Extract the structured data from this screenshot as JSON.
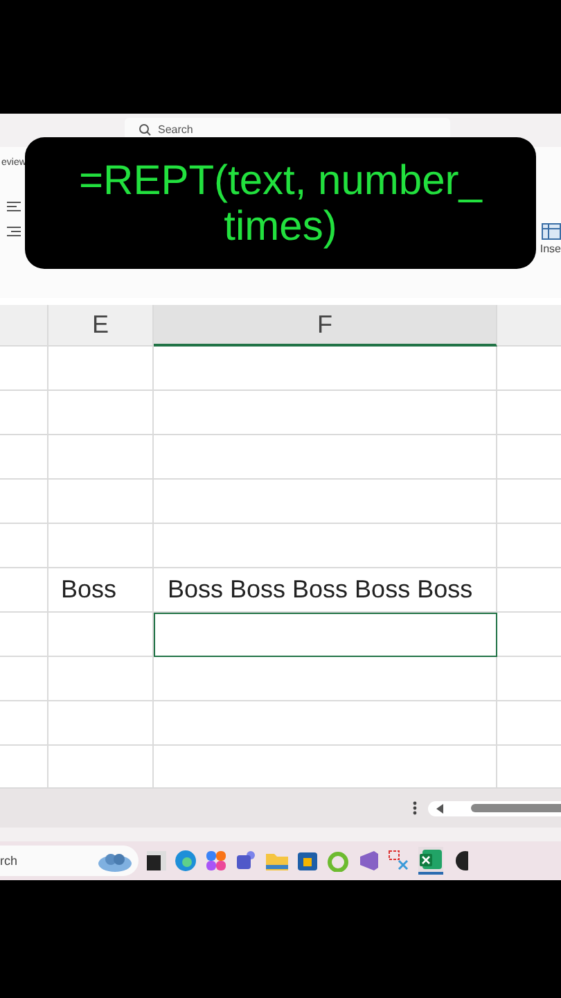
{
  "ribbon": {
    "search": {
      "placeholder": "Search"
    },
    "tab_fragment": "eview",
    "right_button": "Inse"
  },
  "caption": {
    "line_1": "=REPT(text, number_",
    "line_2": "times)"
  },
  "sheet": {
    "columns": [
      {
        "label": "E",
        "selected": false
      },
      {
        "label": "F",
        "selected": true
      }
    ],
    "rows": [
      {
        "cells": [
          {
            "selected": false
          },
          {
            "selected": false
          }
        ]
      },
      {
        "cells": [
          {
            "selected": false
          },
          {
            "selected": false
          }
        ]
      },
      {
        "cells": [
          {
            "selected": false
          },
          {
            "selected": false
          }
        ]
      },
      {
        "cells": [
          {
            "selected": false
          },
          {
            "selected": false
          }
        ]
      },
      {
        "cells": [
          {
            "selected": false
          },
          {
            "selected": false
          }
        ]
      },
      {
        "cells": [
          {
            "text": "Boss",
            "selected": false
          },
          {
            "text": "Boss Boss Boss Boss Boss",
            "selected": false
          }
        ]
      },
      {
        "cells": [
          {
            "selected": false
          },
          {
            "selected": true
          }
        ]
      },
      {
        "cells": [
          {
            "selected": false
          },
          {
            "selected": false
          }
        ]
      },
      {
        "cells": [
          {
            "selected": false
          },
          {
            "selected": false
          }
        ]
      },
      {
        "cells": [
          {
            "selected": false
          },
          {
            "selected": false
          }
        ]
      }
    ]
  },
  "taskbar": {
    "search": {
      "placeholder": "rch"
    }
  }
}
